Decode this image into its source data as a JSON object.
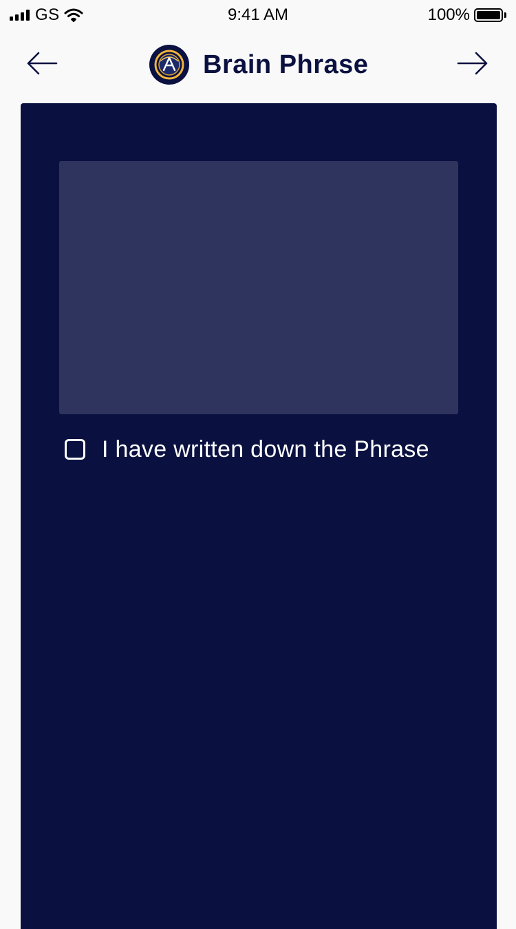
{
  "status_bar": {
    "carrier": "GS",
    "time": "9:41 AM",
    "battery_percent": "100%",
    "battery_level": 1.0,
    "signal_icon": "cellular-signal-icon",
    "wifi_icon": "wifi-icon",
    "battery_icon": "battery-icon"
  },
  "nav": {
    "title": "Brain Phrase",
    "back_icon": "arrow-left-icon",
    "forward_icon": "arrow-right-icon",
    "logo_icon": "app-logo-icon"
  },
  "phrase": {
    "text": ""
  },
  "confirm": {
    "label": "I have written down the Phrase",
    "checked": false
  },
  "colors": {
    "primary": "#0a1140",
    "phrase_box": "#2e345e",
    "background": "#f9f9f9",
    "text_on_primary": "#ffffff",
    "logo_gold": "#f0b43a"
  }
}
